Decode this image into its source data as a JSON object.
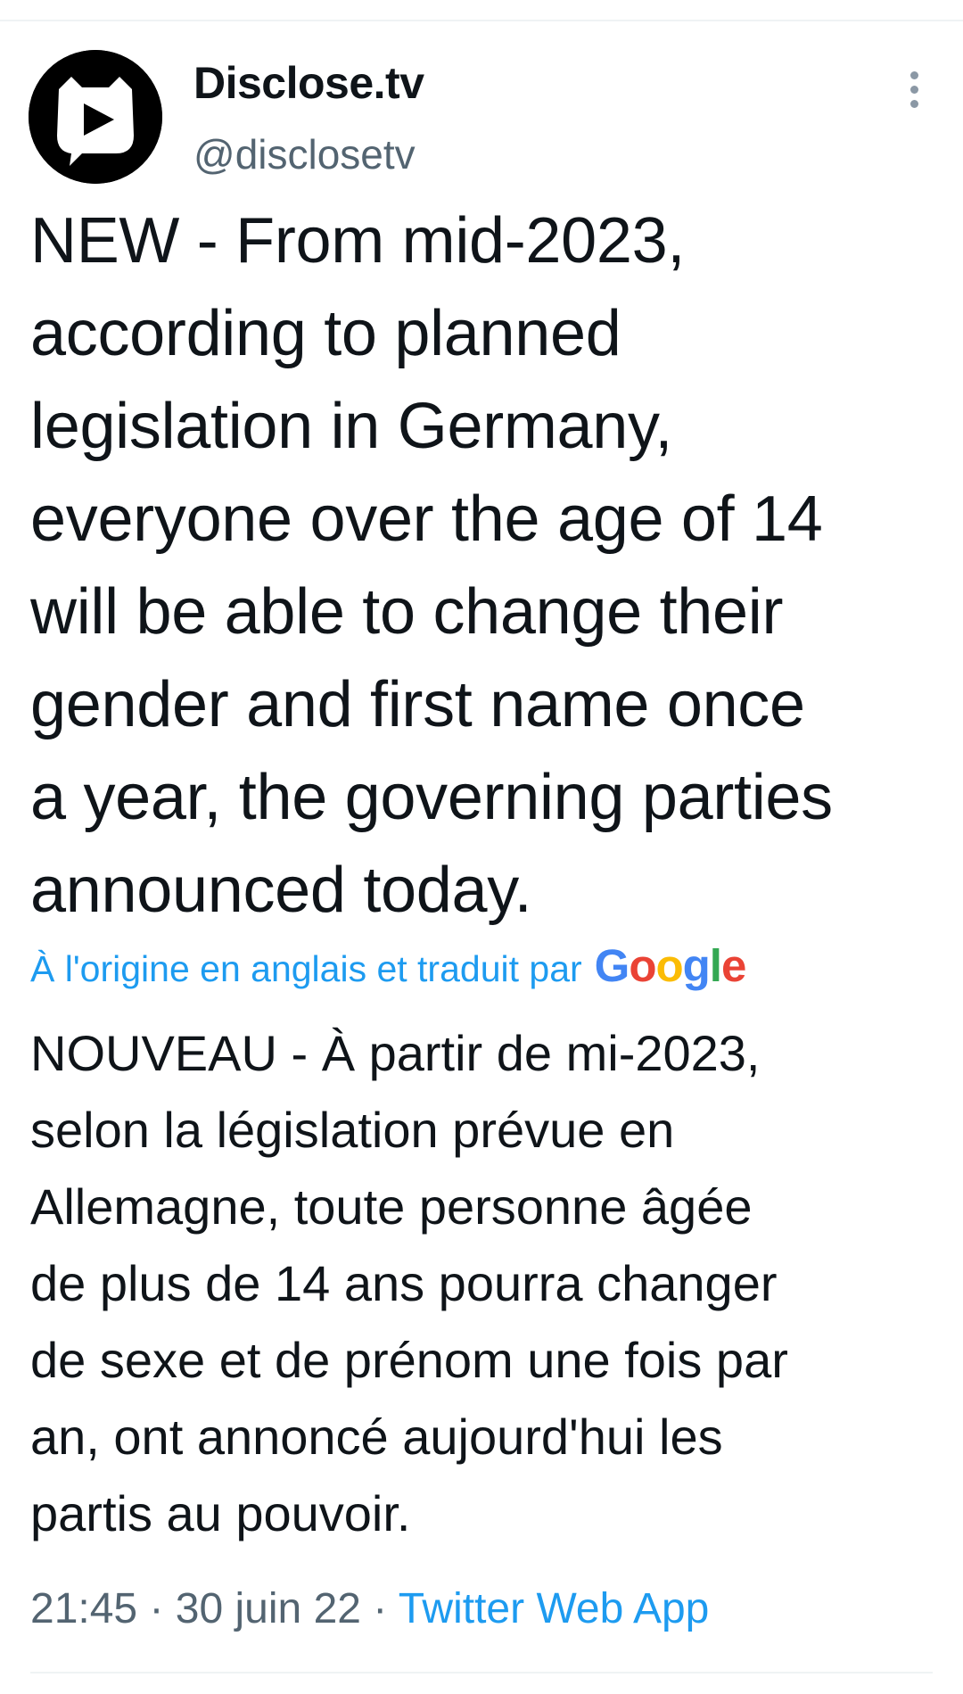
{
  "tweet": {
    "author": {
      "display_name": "Disclose.tv",
      "handle": "@disclosetv",
      "avatar_icon": "disclose-tv-logo-icon"
    },
    "text_lines": [
      "NEW - From mid-2023,",
      "according to planned",
      "legislation in Germany,",
      "everyone over the age of 14",
      "will be able to change their",
      "gender and first name once",
      "a year, the governing parties",
      "announced today."
    ],
    "translation": {
      "label": "À l'origine en anglais et traduit par",
      "provider_letters": [
        "G",
        "o",
        "o",
        "g",
        "l",
        "e"
      ],
      "text_lines": [
        "NOUVEAU - À partir de mi-2023,",
        "selon la législation prévue en",
        "Allemagne, toute personne âgée",
        "de plus de 14 ans pourra changer",
        "de sexe et de prénom une fois par",
        "an, ont annoncé aujourd'hui les",
        "partis au pouvoir."
      ]
    },
    "meta": {
      "time": "21:45",
      "separator": " · ",
      "date": "30 juin 22",
      "source": "Twitter Web App"
    },
    "more_icon": "more-vertical-icon"
  },
  "colors": {
    "link": "#1d9bf0",
    "secondary_text": "#536471",
    "primary_text": "#0f1419",
    "divider": "#eff3f4"
  }
}
